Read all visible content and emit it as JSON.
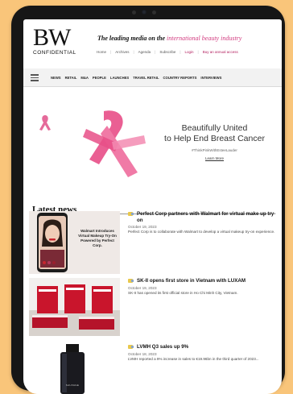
{
  "header": {
    "logo_mark": "BW",
    "logo_sub": "CONFIDENTIAL",
    "tagline_prefix": "The leading media on the",
    "tagline_highlight": "international beauty industry",
    "utility": [
      "Home",
      "Archives",
      "Agenda",
      "Subscribe",
      "Login",
      "Buy an annual access"
    ]
  },
  "nav": {
    "items": [
      "NEWS",
      "RETAIL",
      "M&A",
      "PEOPLE",
      "LAUNCHES",
      "TRAVEL RETAIL",
      "COUNTRY REPORTS",
      "INTERVIEWS"
    ]
  },
  "banner": {
    "headline_line1": "Beautifully United",
    "headline_line2": "to Help End Breast Cancer",
    "hashtag": "#ThinkPinkWithEsteeLauder",
    "learn_more": "Learn More"
  },
  "latest_news": {
    "title": "Latest news",
    "articles": [
      {
        "title": "Perfect Corp partners with Walmart for virtual make up try-on",
        "date": "October 19, 2023",
        "summary": "Perfect Corp is to collaborate with Walmart to develop a virtual makeup try-on experience.",
        "thumb_text": "Walmart Introduces Virtual Makeup Try-On Powered by Perfect Corp."
      },
      {
        "title": "SK-II opens first store in Vietnam with LUXAM",
        "date": "October 19, 2023",
        "summary": "SK-II has opened its first official store in Ho Chi Minh City, Vietnam."
      },
      {
        "title": "LVMH Q3 sales up 9%",
        "date": "October 18, 2023",
        "summary": "LVMH reported a 9% increase in sales to €19.96bn in the third quarter of 2023...",
        "thumb_text": "SAUVAGE"
      }
    ]
  }
}
